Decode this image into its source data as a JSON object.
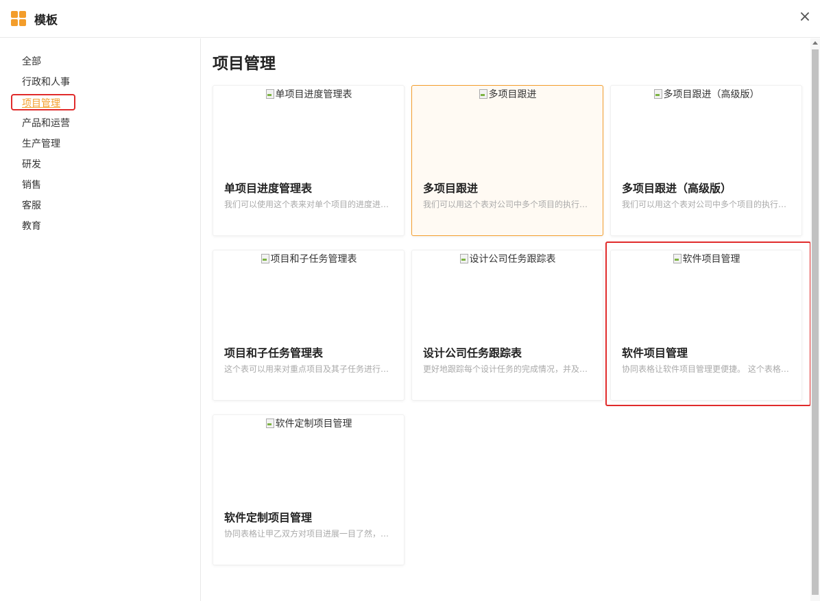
{
  "header": {
    "title": "模板",
    "close_symbol": "×"
  },
  "sidebar": {
    "items": [
      {
        "label": "全部"
      },
      {
        "label": "行政和人事"
      },
      {
        "label": "项目管理",
        "active": true
      },
      {
        "label": "产品和运营"
      },
      {
        "label": "生产管理"
      },
      {
        "label": "研发"
      },
      {
        "label": "销售"
      },
      {
        "label": "客服"
      },
      {
        "label": "教育"
      }
    ]
  },
  "main": {
    "title": "项目管理",
    "cards": [
      {
        "image_alt": "单项目进度管理表",
        "name": "单项目进度管理表",
        "desc": "我们可以使用这个表来对单个项目的进度进行管理"
      },
      {
        "image_alt": "多项目跟进",
        "name": "多项目跟进",
        "desc": "我们可以用这个表对公司中多个项目的执行情况进行跟进"
      },
      {
        "image_alt": "多项目跟进（高级版）",
        "name": "多项目跟进（高级版）",
        "desc": "我们可以用这个表对公司中多个项目的执行情况进行跟进"
      },
      {
        "image_alt": "项目和子任务管理表",
        "name": "项目和子任务管理表",
        "desc": "这个表可以用来对重点项目及其子任务进行管理"
      },
      {
        "image_alt": "设计公司任务跟踪表",
        "name": "设计公司任务跟踪表",
        "desc": "更好地跟踪每个设计任务的完成情况，并及时调整"
      },
      {
        "image_alt": "软件项目管理",
        "name": "软件项目管理",
        "desc": "协同表格让软件项目管理更便捷。 这个表格可以帮助"
      },
      {
        "image_alt": "软件定制项目管理",
        "name": "软件定制项目管理",
        "desc": "协同表格让甲乙双方对项目进展一目了然，沟通更高效"
      }
    ]
  },
  "colors": {
    "accent": "#f39d2b",
    "highlight": "#e02a2a"
  }
}
